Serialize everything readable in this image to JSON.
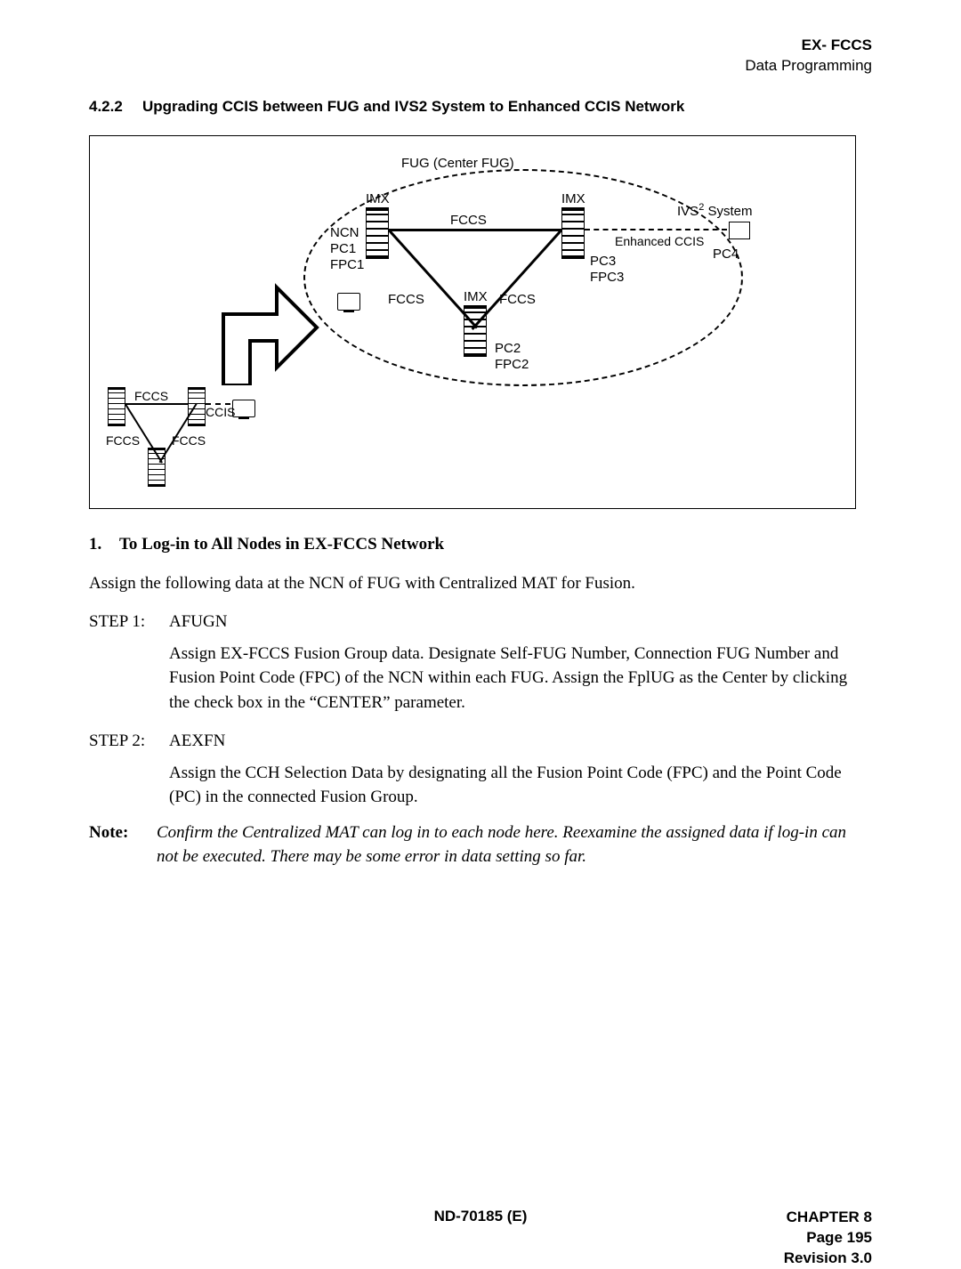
{
  "header": {
    "line1": "EX- FCCS",
    "line2": "Data Programming"
  },
  "section": {
    "number": "4.2.2",
    "title": "Upgrading CCIS between FUG and IVS2 System to Enhanced CCIS Network"
  },
  "diagram": {
    "fug_title": "FUG (Center FUG)",
    "imx": "IMX",
    "ncn": "NCN",
    "pc1": "PC1",
    "fpc1": "FPC1",
    "pc2": "PC2",
    "fpc2": "FPC2",
    "pc3": "PC3",
    "fpc3": "FPC3",
    "pc4": "PC4",
    "fccs": "FCCS",
    "ccis": "CCIS",
    "enh": "Enhanced CCIS",
    "ivs_prefix": "IVS",
    "ivs_sup": "2",
    "ivs_suffix": " System"
  },
  "subheading": {
    "num": "1.",
    "text": "To Log-in to All Nodes in EX-FCCS Network"
  },
  "intro": "Assign the following data at the NCN of FUG with Centralized MAT for Fusion.",
  "steps": [
    {
      "label": "STEP 1:",
      "name": "AFUGN",
      "body": "Assign EX-FCCS Fusion Group data. Designate Self-FUG Number, Connection FUG Number and Fusion Point Code (FPC) of the NCN within each FUG. Assign the FplUG as the Center by clicking the check box in the “CENTER” parameter."
    },
    {
      "label": "STEP 2:",
      "name": "AEXFN",
      "body": "Assign the CCH Selection Data by designating all the Fusion Point Code (FPC) and the Point Code (PC) in the connected Fusion Group."
    }
  ],
  "note": {
    "label": "Note:",
    "body": "Confirm the Centralized MAT can log in to each node here. Reexamine the assigned data if log-in can not be executed. There may be some error in data setting so far."
  },
  "footer": {
    "center": "ND-70185 (E)",
    "chapter": "CHAPTER 8",
    "page": "Page 195",
    "rev": "Revision 3.0"
  }
}
